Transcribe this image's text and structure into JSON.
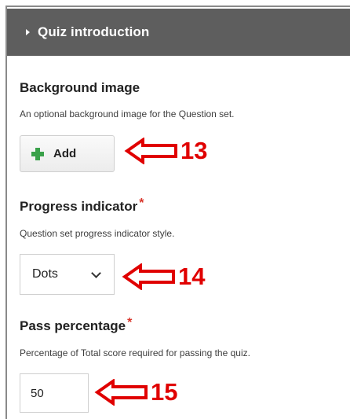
{
  "section": {
    "title": "Quiz introduction"
  },
  "background_image": {
    "label": "Background image",
    "description": "An optional background image for the Question set.",
    "add_label": "Add"
  },
  "progress_indicator": {
    "label": "Progress indicator",
    "required_mark": "*",
    "description": "Question set progress indicator style.",
    "selected": "Dots"
  },
  "pass_percentage": {
    "label": "Pass percentage",
    "required_mark": "*",
    "description": "Percentage of Total score required for passing the quiz.",
    "value": "50"
  },
  "annotations": [
    {
      "number": "13"
    },
    {
      "number": "14"
    },
    {
      "number": "15"
    }
  ],
  "colors": {
    "header_bg": "#5e5e5e",
    "required": "#d9362b",
    "annotation": "#e00000",
    "add_icon": "#3aa14a"
  }
}
